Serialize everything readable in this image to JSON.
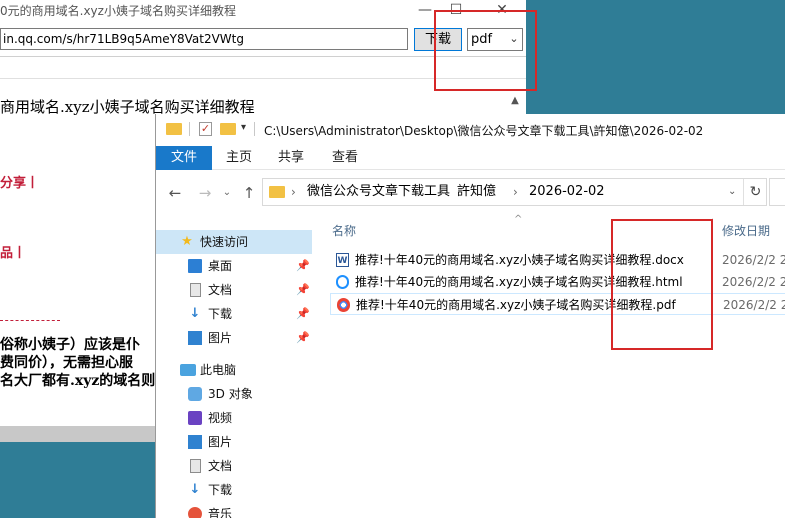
{
  "background_window": {
    "title": "0元的商用域名.xyz小姨子域名购买详细教程",
    "url": "in.qq.com/s/hr71LB9q5AmeY8Vat2VWtg",
    "download_label": "下载",
    "format_value": "pdf",
    "heading": "商用域名.xyz小姨子域名购买详细教程",
    "share_fragment": "分享丨",
    "product_fragment": "品丨",
    "para_line1": "俗称小姨子）应该是仆",
    "para_line2": "费同价），无需担心服",
    "para_line3": "名大厂都有.xyz的域名则"
  },
  "explorer": {
    "title_path": "C:\\Users\\Administrator\\Desktop\\微信公众号文章下载工具\\許知億\\2026-02-02",
    "ribbon_tabs": {
      "file": "文件",
      "home": "主页",
      "share": "共享",
      "view": "查看"
    },
    "address": {
      "crumb1": "微信公众号文章下载工具",
      "crumb2": "許知億",
      "crumb3": "2026-02-02"
    },
    "sidebar": {
      "quick_access": "快速访问",
      "desktop": "桌面",
      "documents": "文档",
      "downloads": "下载",
      "pictures": "图片",
      "this_pc": "此电脑",
      "objects3d": "3D 对象",
      "videos": "视频",
      "pictures2": "图片",
      "documents2": "文档",
      "downloads2": "下载",
      "music": "音乐"
    },
    "columns": {
      "name": "名称",
      "date_modified": "修改日期"
    },
    "files": [
      {
        "name": "推荐!十年40元的商用域名.xyz小姨子域名购买详细教程.docx",
        "date": "2026/2/2 2",
        "type": "docx"
      },
      {
        "name": "推荐!十年40元的商用域名.xyz小姨子域名购买详细教程.html",
        "date": "2026/2/2 2",
        "type": "html"
      },
      {
        "name": "推荐!十年40元的商用域名.xyz小姨子域名购买详细教程.pdf",
        "date": "2026/2/2 2",
        "type": "pdf"
      }
    ]
  },
  "colors": {
    "accent": "#1979ca",
    "annotation_red": "#d62828",
    "desktop_bg": "#2f7d96"
  }
}
